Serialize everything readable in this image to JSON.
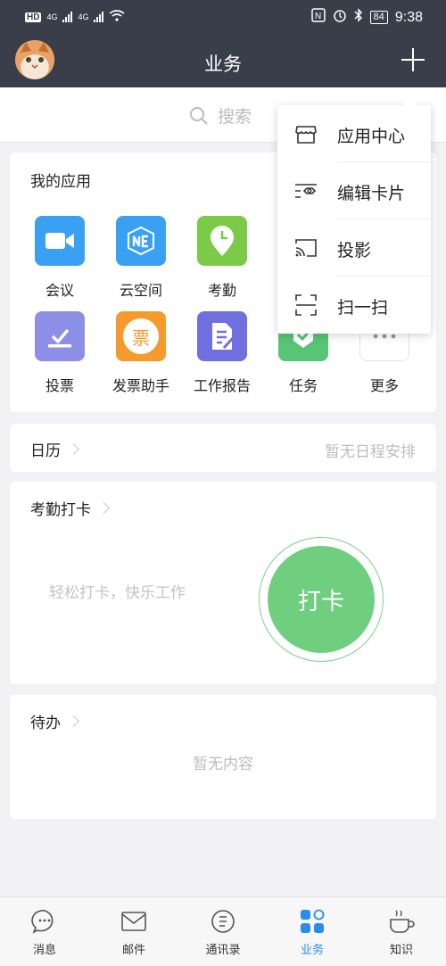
{
  "status_bar": {
    "hd": "HD",
    "net1": "4G",
    "net2": "4G",
    "battery": "84",
    "time": "9:38"
  },
  "header": {
    "title": "业务"
  },
  "search": {
    "placeholder": "搜索"
  },
  "apps": {
    "title": "我的应用",
    "items": [
      {
        "label": "会议",
        "icon": "video-camera-icon",
        "color": "#3aa0f2"
      },
      {
        "label": "云空间",
        "icon": "cloud-space-icon",
        "color": "#3aa0f2"
      },
      {
        "label": "考勤",
        "icon": "clock-pin-icon",
        "color": "#7ccb48"
      },
      {
        "label": "投票",
        "icon": "vote-icon",
        "color": "#8d8fe6"
      },
      {
        "label": "发票助手",
        "icon": "invoice-icon",
        "color": "#f59b2d",
        "glyph": "票"
      },
      {
        "label": "工作报告",
        "icon": "report-icon",
        "color": "#6f6fe0"
      },
      {
        "label": "任务",
        "icon": "task-check-icon",
        "color": "#58c476"
      },
      {
        "label": "更多",
        "icon": "more-dots-icon",
        "color": "#ffffff"
      }
    ]
  },
  "calendar": {
    "title": "日历",
    "empty_text": "暂无日程安排"
  },
  "attendance": {
    "title": "考勤打卡",
    "slogan": "轻松打卡，快乐工作",
    "button_label": "打卡"
  },
  "todo": {
    "title": "待办",
    "empty_text": "暂无内容"
  },
  "menu": {
    "items": [
      {
        "label": "应用中心",
        "icon": "store-icon"
      },
      {
        "label": "编辑卡片",
        "icon": "edit-card-icon"
      },
      {
        "label": "投影",
        "icon": "cast-icon"
      },
      {
        "label": "扫一扫",
        "icon": "scan-icon"
      }
    ]
  },
  "bottom_nav": {
    "items": [
      {
        "label": "消息",
        "icon": "chat-bubble-icon"
      },
      {
        "label": "邮件",
        "icon": "mail-icon"
      },
      {
        "label": "通讯录",
        "icon": "contacts-icon"
      },
      {
        "label": "业务",
        "icon": "apps-grid-icon",
        "active": true
      },
      {
        "label": "知识",
        "icon": "coffee-cup-icon"
      }
    ],
    "active_color": "#2b8cf0"
  }
}
